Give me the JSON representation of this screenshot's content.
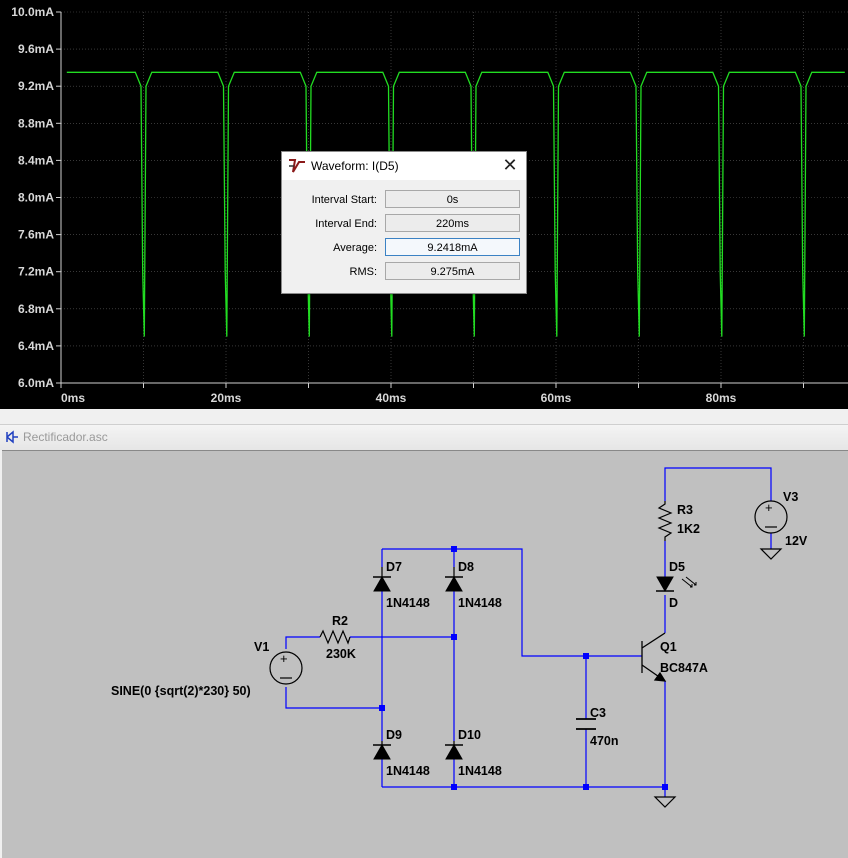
{
  "plot": {
    "trace_color": "#22dd22",
    "grid_color": "#5a5a5a",
    "ytick_labels": [
      "10.0mA",
      "9.6mA",
      "9.2mA",
      "8.8mA",
      "8.4mA",
      "8.0mA",
      "7.6mA",
      "7.2mA",
      "6.8mA",
      "6.4mA",
      "6.0mA"
    ],
    "xtick_labels": [
      "0ms",
      "20ms",
      "40ms",
      "60ms",
      "80ms"
    ]
  },
  "chart_data": {
    "type": "line",
    "series": [
      {
        "x": [
          0.7,
          1,
          9,
          9.7,
          9.9,
          10.1,
          10.3,
          11,
          19,
          19.7,
          19.9,
          20.1,
          20.3,
          21,
          29,
          29.7,
          29.9,
          30.1,
          30.3,
          31,
          39,
          39.7,
          39.9,
          40.1,
          40.3,
          41,
          49,
          49.7,
          49.9,
          50.1,
          50.3,
          51,
          59,
          59.7,
          59.9,
          60.1,
          60.3,
          61,
          69,
          69.7,
          69.9,
          70.1,
          70.3,
          71,
          79,
          79.7,
          79.9,
          80.1,
          80.3,
          81,
          89,
          89.7,
          89.9,
          90.1,
          90.3,
          91,
          95
        ],
        "y": [
          9.35,
          9.35,
          9.35,
          9.2,
          7.2,
          6.5,
          9.2,
          9.35,
          9.35,
          9.2,
          7.2,
          6.5,
          9.2,
          9.35,
          9.35,
          9.2,
          7.2,
          6.5,
          9.2,
          9.35,
          9.35,
          9.2,
          7.2,
          6.5,
          9.2,
          9.35,
          9.35,
          9.2,
          7.2,
          6.5,
          9.2,
          9.35,
          9.35,
          9.2,
          7.2,
          6.5,
          9.2,
          9.35,
          9.35,
          9.2,
          7.2,
          6.5,
          9.2,
          9.35,
          9.35,
          9.2,
          7.2,
          6.5,
          9.2,
          9.35,
          9.35,
          9.2,
          7.2,
          6.5,
          9.2,
          9.35,
          9.35
        ]
      }
    ],
    "xticks": [
      "0ms",
      "20ms",
      "40ms",
      "60ms",
      "80ms"
    ],
    "yticks": [
      "10.0mA",
      "9.6mA",
      "9.2mA",
      "8.8mA",
      "8.4mA",
      "8.0mA",
      "7.6mA",
      "7.2mA",
      "6.8mA",
      "6.4mA",
      "6.0mA"
    ],
    "xlim": [
      0,
      95
    ],
    "ylim": [
      6.0,
      10.0
    ],
    "grid": true
  },
  "dialog": {
    "title": "Waveform: I(D5)",
    "close_glyph": "✕",
    "rows": [
      {
        "label": "Interval Start:",
        "value": "0s"
      },
      {
        "label": "Interval End:",
        "value": "220ms"
      },
      {
        "label": "Average:",
        "value": "9.2418mA"
      },
      {
        "label": "RMS:",
        "value": "9.275mA"
      }
    ]
  },
  "schematic": {
    "window_title": "Rectificador.asc",
    "wire_color": "#0000ff",
    "canvas_color": "#c0c0c0",
    "components": {
      "v1": {
        "name": "V1",
        "value": "SINE(0 {sqrt(2)*230} 50)"
      },
      "r2": {
        "name": "R2",
        "value": "230K"
      },
      "d7": {
        "name": "D7",
        "value": "1N4148"
      },
      "d8": {
        "name": "D8",
        "value": "1N4148"
      },
      "d9": {
        "name": "D9",
        "value": "1N4148"
      },
      "d10": {
        "name": "D10",
        "value": "1N4148"
      },
      "c3": {
        "name": "C3",
        "value": "470n"
      },
      "q1": {
        "name": "Q1",
        "value": "BC847A"
      },
      "r3": {
        "name": "R3",
        "value": "1K2"
      },
      "d5": {
        "name": "D5",
        "value": "D"
      },
      "v3": {
        "name": "V3",
        "value": "12V"
      }
    }
  }
}
